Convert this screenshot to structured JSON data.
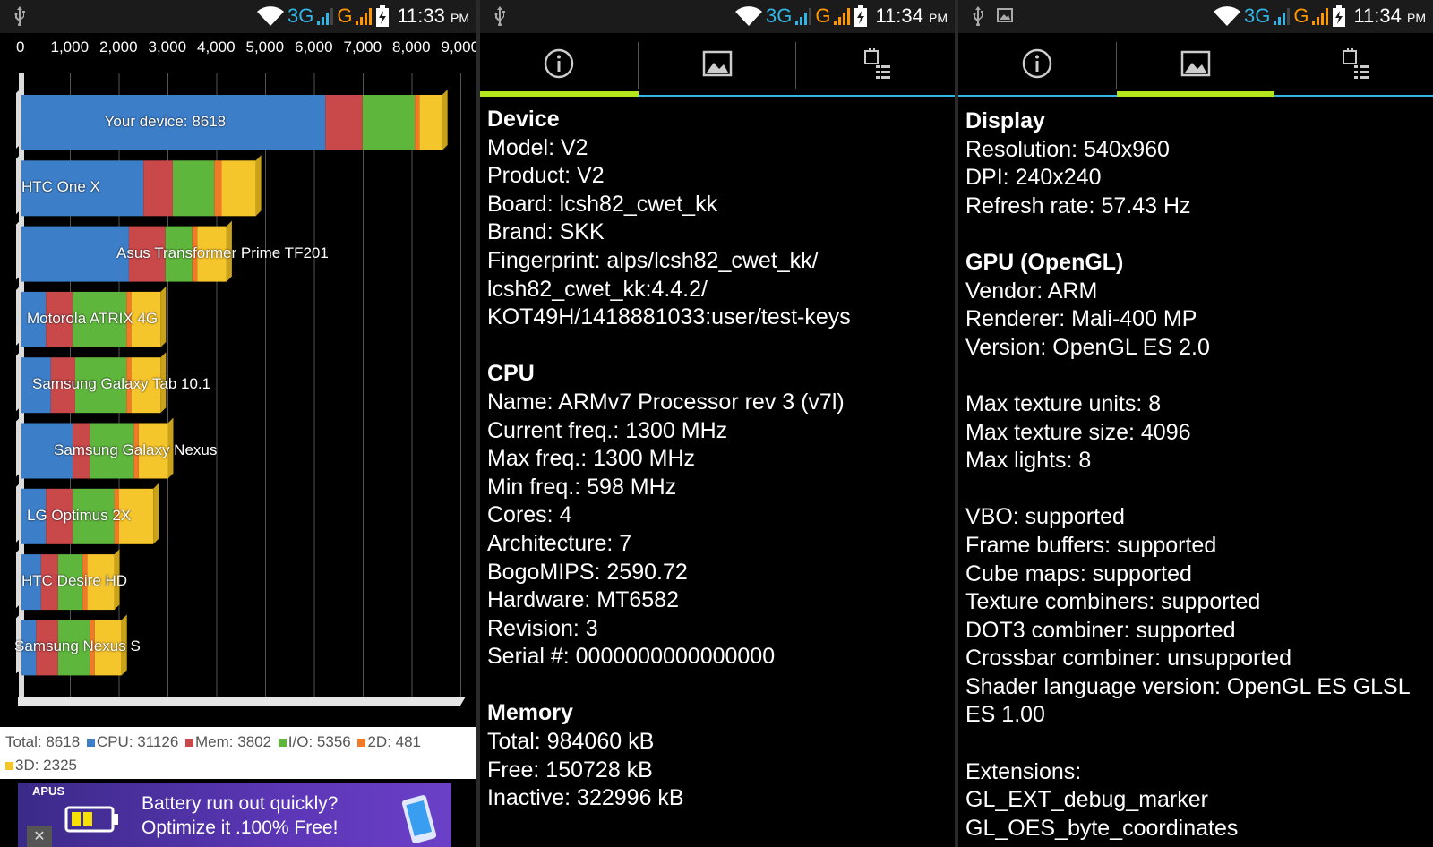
{
  "status_left": {
    "time": "11:33",
    "ampm": "PM"
  },
  "status_mid": {
    "time": "11:34",
    "ampm": "PM"
  },
  "status_right": {
    "time": "11:34",
    "ampm": "PM"
  },
  "network": {
    "net_3g": "3G",
    "net_g": "G"
  },
  "colors": {
    "accent": "#b4e61e",
    "tab_line": "#33b5e5",
    "cpu": "#3d7ec8",
    "mem": "#c9484a",
    "io": "#5fb63d",
    "d2": "#f07a28",
    "d3": "#f5c52c"
  },
  "chart_data": {
    "type": "bar",
    "orientation": "horizontal",
    "stacked": true,
    "xlim": [
      0,
      9000
    ],
    "ticks": [
      "0",
      "1,000",
      "2,000",
      "3,000",
      "4,000",
      "5,000",
      "6,000",
      "7,000",
      "8,000",
      "9,000"
    ],
    "categories": [
      "Your device: 8618",
      "HTC One X",
      "Asus Transformer Prime TF201",
      "Motorola ATRIX 4G",
      "Samsung Galaxy Tab 10.1",
      "Samsung Galaxy Nexus",
      "LG Optimus 2X",
      "HTC Desire HD",
      "Samsung Nexus S"
    ],
    "series": [
      {
        "name": "CPU",
        "values": [
          6226,
          2500,
          2200,
          500,
          600,
          1050,
          500,
          400,
          300
        ]
      },
      {
        "name": "Mem",
        "values": [
          760,
          600,
          750,
          550,
          500,
          350,
          550,
          350,
          450
        ]
      },
      {
        "name": "I/O",
        "values": [
          1071,
          850,
          550,
          1100,
          1050,
          900,
          850,
          500,
          650
        ]
      },
      {
        "name": "2D",
        "values": [
          96,
          150,
          100,
          100,
          100,
          100,
          100,
          100,
          100
        ]
      },
      {
        "name": "3D",
        "values": [
          465,
          700,
          600,
          600,
          600,
          600,
          700,
          550,
          550
        ]
      }
    ]
  },
  "legend": {
    "total": "Total: 8618",
    "cpu": "CPU: 31126",
    "mem": "Mem: 3802",
    "io": "I/O: 5356",
    "d2": "2D: 481",
    "d3": "3D: 2325"
  },
  "ad": {
    "brand": "APUS",
    "line1": "Battery run out quickly?",
    "line2": "Optimize it .100% Free!",
    "close": "✕"
  },
  "device_info": {
    "device_h": "Device",
    "model": "Model: V2",
    "product": "Product: V2",
    "board": "Board: lcsh82_cwet_kk",
    "brand": "Brand: SKK",
    "fp1": "Fingerprint: alps/lcsh82_cwet_kk/",
    "fp2": "lcsh82_cwet_kk:4.4.2/",
    "fp3": "KOT49H/1418881033:user/test-keys",
    "cpu_h": "CPU",
    "name": "Name: ARMv7 Processor rev 3 (v7l)",
    "cur": "Current freq.: 1300 MHz",
    "max": "Max freq.: 1300 MHz",
    "min": "Min freq.: 598 MHz",
    "cores": "Cores: 4",
    "arch": "Architecture: 7",
    "bogo": "BogoMIPS: 2590.72",
    "hw": "Hardware: MT6582",
    "rev": "Revision: 3",
    "serial": "Serial #: 0000000000000000",
    "mem_h": "Memory",
    "total": "Total: 984060 kB",
    "free": "Free: 150728 kB",
    "inactive": "Inactive: 322996 kB"
  },
  "display_info": {
    "display_h": "Display",
    "res": "Resolution: 540x960",
    "dpi": "DPI: 240x240",
    "refresh": "Refresh rate: 57.43 Hz",
    "gpu_h": "GPU (OpenGL)",
    "vendor": "Vendor: ARM",
    "renderer": "Renderer: Mali-400 MP",
    "version": "Version: OpenGL ES 2.0",
    "tex_units": "Max texture units: 8",
    "tex_size": "Max texture size: 4096",
    "lights": "Max lights: 8",
    "vbo": "VBO: supported",
    "fb": "Frame buffers: supported",
    "cube": "Cube maps: supported",
    "texcomb": "Texture combiners: supported",
    "dot3": "DOT3 combiner: supported",
    "crossbar": "Crossbar combiner: unsupported",
    "shader1": "Shader language version: OpenGL ES GLSL",
    "shader2": "ES 1.00",
    "ext_h": "Extensions:",
    "ext1": "GL_EXT_debug_marker",
    "ext2": "GL_OES_byte_coordinates"
  },
  "icons": {
    "usb": "usb-icon",
    "wifi": "wifi-icon",
    "battery": "battery-charging-icon",
    "info": "info-icon",
    "image": "image-icon",
    "device": "device-list-icon"
  }
}
